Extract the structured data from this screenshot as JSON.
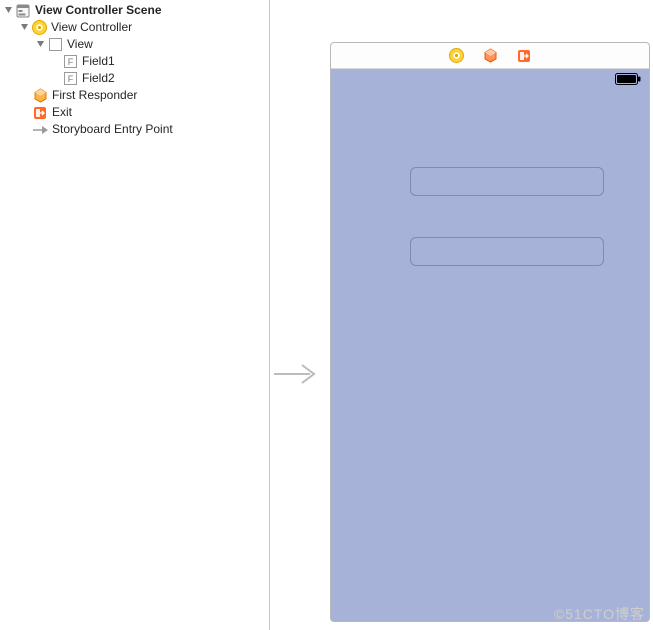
{
  "outline": {
    "scene_label": "View Controller Scene",
    "vc_label": "View Controller",
    "view_label": "View",
    "field1_label": "Field1",
    "field2_label": "Field2",
    "first_responder_label": "First Responder",
    "exit_label": "Exit",
    "entry_point_label": "Storyboard Entry Point"
  },
  "watermark": "©51CTO博客"
}
